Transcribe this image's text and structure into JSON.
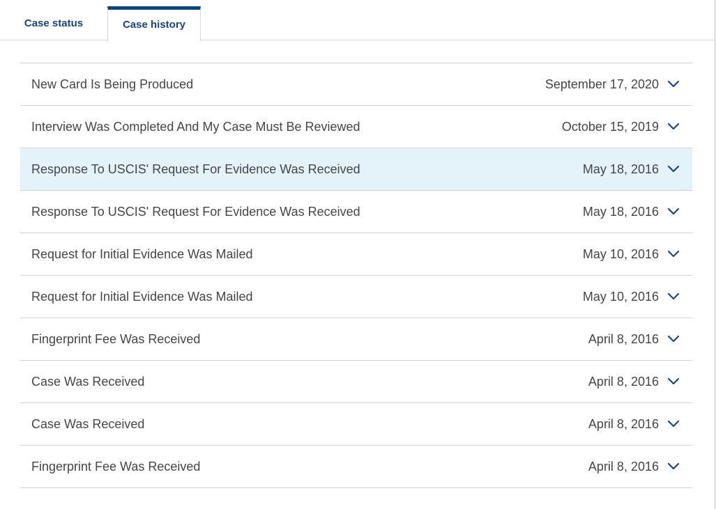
{
  "tabs": [
    {
      "label": "Case status",
      "active": false
    },
    {
      "label": "Case history",
      "active": true
    }
  ],
  "history": [
    {
      "title": "New Card Is Being Produced",
      "date": "September 17, 2020",
      "icon": "chevron-down-icon"
    },
    {
      "title": "Interview Was Completed And My Case Must Be Reviewed",
      "date": "October 15, 2019",
      "icon": "chevron-down-icon"
    },
    {
      "title": "Response To USCIS' Request For Evidence Was Received",
      "date": "May 18, 2016",
      "icon": "chevron-down-icon",
      "highlighted": true
    },
    {
      "title": "Response To USCIS' Request For Evidence Was Received",
      "date": "May 18, 2016",
      "icon": "chevron-down-icon"
    },
    {
      "title": "Request for Initial Evidence Was Mailed",
      "date": "May 10, 2016",
      "icon": "chevron-down-icon"
    },
    {
      "title": "Request for Initial Evidence Was Mailed",
      "date": "May 10, 2016",
      "icon": "chevron-down-icon"
    },
    {
      "title": "Fingerprint Fee Was Received",
      "date": "April 8, 2016",
      "icon": "chevron-down-icon"
    },
    {
      "title": "Case Was Received",
      "date": "April 8, 2016",
      "icon": "chevron-down-icon"
    },
    {
      "title": "Case Was Received",
      "date": "April 8, 2016",
      "icon": "chevron-down-icon"
    },
    {
      "title": "Fingerprint Fee Was Received",
      "date": "April 8, 2016",
      "icon": "chevron-down-icon"
    }
  ],
  "colors": {
    "accent": "#0b4778",
    "tab_text": "#1a4480",
    "row_text": "#454545",
    "highlight": "#e4f3fa",
    "divider": "#d0d0d0"
  }
}
